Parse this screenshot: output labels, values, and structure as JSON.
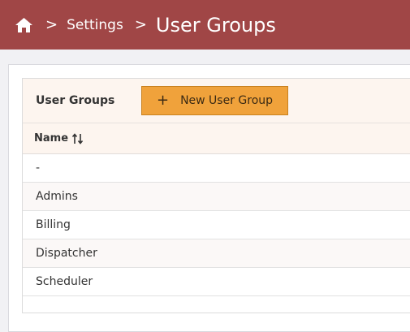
{
  "breadcrumb": {
    "parent": "Settings",
    "current": "User Groups",
    "separator": ">"
  },
  "panel": {
    "title": "User Groups",
    "new_button_label": "New User Group",
    "new_button_icon": "+"
  },
  "table": {
    "columns": [
      "Name"
    ],
    "rows": [
      "-",
      "Admins",
      "Billing",
      "Dispatcher",
      "Scheduler"
    ]
  },
  "colors": {
    "header_bar": "#a04646",
    "accent_button": "#f0a23b",
    "panel_header_bg": "#fdf5ef"
  }
}
